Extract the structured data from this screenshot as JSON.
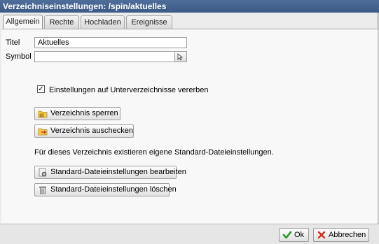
{
  "window": {
    "title": "Verzeichniseinstellungen: /spin/aktuelles"
  },
  "tabs": [
    {
      "label": "Allgemein",
      "active": true
    },
    {
      "label": "Rechte",
      "active": false
    },
    {
      "label": "Hochladen",
      "active": false
    },
    {
      "label": "Ereignisse",
      "active": false
    }
  ],
  "form": {
    "title_label": "Titel",
    "title_value": "Aktuelles",
    "symbol_label": "Symbol",
    "symbol_value": ""
  },
  "inherit": {
    "label": "Einstellungen auf Unterverzeichnisse vererben",
    "checked": true,
    "check_glyph": "✓"
  },
  "buttons": {
    "lock": "Verzeichnis sperren",
    "checkout": "Verzeichnis auschecken",
    "edit_defaults": "Standard-Dateieinstellungen bearbeiten",
    "delete_defaults": "Standard-Dateieinstellungen löschen"
  },
  "info_text": "Für dieses Verzeichnis existieren eigene Standard-Dateieinstellungen.",
  "footer": {
    "ok": "Ok",
    "cancel": "Abbrechen"
  },
  "colors": {
    "titlebar": "#3b5a86",
    "ok_check": "#2e9b2e",
    "cancel_x": "#d42a1e"
  }
}
